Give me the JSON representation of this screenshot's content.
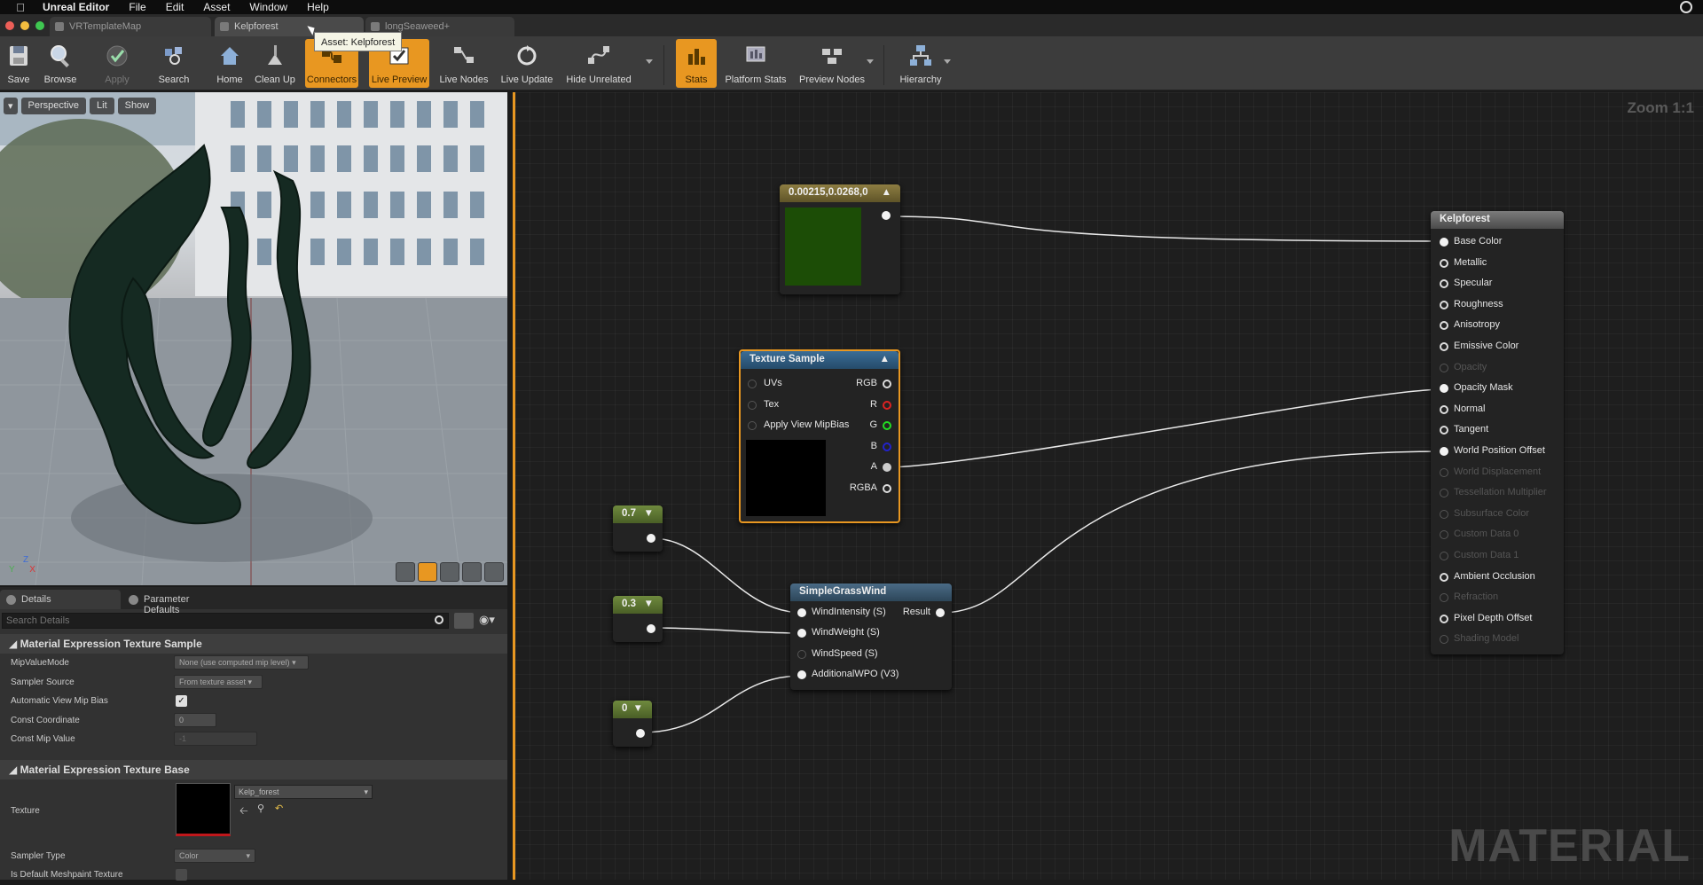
{
  "menubar": {
    "app": "Unreal Editor",
    "items": [
      "File",
      "Edit",
      "Asset",
      "Window",
      "Help"
    ]
  },
  "tabs": [
    {
      "label": "VRTemplateMap"
    },
    {
      "label": "Kelpforest"
    },
    {
      "label": "longSeaweed+"
    }
  ],
  "tooltip": "Asset: Kelpforest",
  "toolbar": {
    "save": "Save",
    "browse": "Browse",
    "apply": "Apply",
    "search": "Search",
    "home": "Home",
    "cleanup": "Clean Up",
    "connectors": "Connectors",
    "live_preview": "Live Preview",
    "live_nodes": "Live Nodes",
    "live_update": "Live Update",
    "hide_unrelated": "Hide Unrelated",
    "stats": "Stats",
    "platform_stats": "Platform Stats",
    "preview_nodes": "Preview Nodes",
    "hierarchy": "Hierarchy"
  },
  "viewport": {
    "perspective": "Perspective",
    "lit": "Lit",
    "show": "Show",
    "axis_z": "Z",
    "axis_y": "Y",
    "axis_x": "X"
  },
  "details": {
    "tab_details": "Details",
    "tab_params": "Parameter Defaults",
    "search_placeholder": "Search Details",
    "section1": "Material Expression Texture Sample",
    "rows1": [
      {
        "name": "MipValueMode",
        "value": "None (use computed mip level)"
      },
      {
        "name": "Sampler Source",
        "value": "From texture asset"
      },
      {
        "name": "Automatic View Mip Bias",
        "value": "✓"
      },
      {
        "name": "Const Coordinate",
        "value": "0"
      },
      {
        "name": "Const Mip Value",
        "value": "-1"
      }
    ],
    "section2": "Material Expression Texture Base",
    "texture_label": "Texture",
    "texture_value": "Kelp_forest",
    "sampler_type_label": "Sampler Type",
    "sampler_type_value": "Color",
    "default_meshpaint_label": "Is Default Meshpaint Texture"
  },
  "graph": {
    "zoom": "Zoom 1:1",
    "watermark": "MATERIAL",
    "const_vec": {
      "title": "0.00215,0.0268,0",
      "color": "#1c4d06"
    },
    "texture_sample": {
      "title": "Texture Sample",
      "inputs": [
        "UVs",
        "Tex",
        "Apply View MipBias"
      ],
      "outputs": [
        "RGB",
        "R",
        "G",
        "B",
        "A",
        "RGBA"
      ]
    },
    "scalar1": "0.7",
    "scalar2": "0.3",
    "scalar3": "0",
    "grass_wind": {
      "title": "SimpleGrassWind",
      "inputs": [
        "WindIntensity (S)",
        "WindWeight (S)",
        "WindSpeed (S)",
        "AdditionalWPO (V3)"
      ],
      "output": "Result"
    },
    "result": {
      "title": "Kelpforest",
      "inputs": [
        {
          "label": "Base Color",
          "active": true
        },
        {
          "label": "Metallic",
          "active": true
        },
        {
          "label": "Specular",
          "active": true
        },
        {
          "label": "Roughness",
          "active": true
        },
        {
          "label": "Anisotropy",
          "active": true
        },
        {
          "label": "Emissive Color",
          "active": true
        },
        {
          "label": "Opacity",
          "active": false
        },
        {
          "label": "Opacity Mask",
          "active": true
        },
        {
          "label": "Normal",
          "active": true
        },
        {
          "label": "Tangent",
          "active": true
        },
        {
          "label": "World Position Offset",
          "active": true
        },
        {
          "label": "World Displacement",
          "active": false
        },
        {
          "label": "Tessellation Multiplier",
          "active": false
        },
        {
          "label": "Subsurface Color",
          "active": false
        },
        {
          "label": "Custom Data 0",
          "active": false
        },
        {
          "label": "Custom Data 1",
          "active": false
        },
        {
          "label": "Ambient Occlusion",
          "active": true
        },
        {
          "label": "Refraction",
          "active": false
        },
        {
          "label": "Pixel Depth Offset",
          "active": true
        },
        {
          "label": "Shading Model",
          "active": false
        }
      ]
    }
  }
}
